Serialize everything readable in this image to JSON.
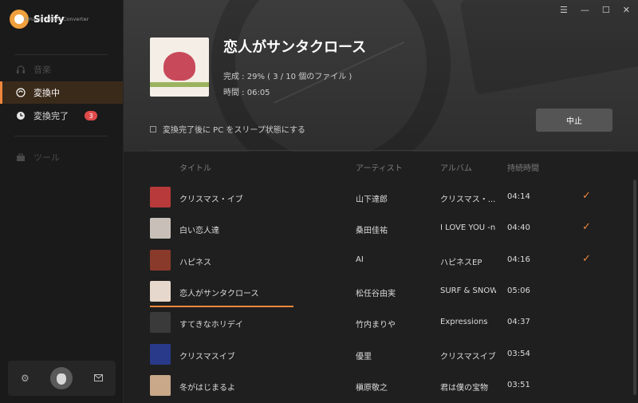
{
  "app": {
    "name": "Sidify",
    "subtitle": "Amazon Music Converter"
  },
  "sidebar": {
    "items": [
      {
        "label": "音楽",
        "icon": "headphones-icon",
        "state": "dim"
      },
      {
        "label": "変換中",
        "icon": "converting-icon",
        "state": "active"
      },
      {
        "label": "変換完了",
        "icon": "clock-icon",
        "state": "normal",
        "badge": "3"
      },
      {
        "label": "ツール",
        "icon": "toolbox-icon",
        "state": "dim"
      }
    ],
    "footer": {
      "settings_icon": "gear-icon",
      "avatar_icon": "avatar",
      "mail_icon": "mail-icon"
    }
  },
  "window_controls": [
    "☰",
    "—",
    "☐",
    "✕"
  ],
  "now_converting": {
    "title": "恋人がサンタクロース",
    "progress": "完成 : 29% ( 3 / 10 個のファイル )",
    "time": "時間 :  06:05",
    "sleep_option": "変換完了後に PC をスリープ状態にする",
    "stop_label": "中止"
  },
  "table": {
    "headers": {
      "title": "タイトル",
      "artist": "アーティスト",
      "album": "アルバム",
      "duration": "持続時間"
    },
    "rows": [
      {
        "title": "クリスマス・イブ",
        "artist": "山下達郎",
        "album": "クリスマス・...",
        "duration": "04:14",
        "done": true,
        "color": "#b83a3a"
      },
      {
        "title": "白い恋人達",
        "artist": "桑田佳祐",
        "album": "I LOVE YOU -n...",
        "duration": "04:40",
        "done": true,
        "color": "#c8c0b8"
      },
      {
        "title": "ハピネス",
        "artist": "AI",
        "album": "ハピネスEP",
        "duration": "04:16",
        "done": true,
        "color": "#8a3a2a"
      },
      {
        "title": "恋人がサンタクロース",
        "artist": "松任谷由実",
        "album": "SURF & SNOW",
        "duration": "05:06",
        "done": false,
        "current": true,
        "color": "#e6d8cc"
      },
      {
        "title": "すてきなホリデイ",
        "artist": "竹内まりや",
        "album": "Expressions",
        "duration": "04:37",
        "done": false,
        "color": "#3a3a3a"
      },
      {
        "title": "クリスマスイブ",
        "artist": "優里",
        "album": "クリスマスイブ",
        "duration": "03:54",
        "done": false,
        "color": "#2a3a8a"
      },
      {
        "title": "冬がはじまるよ",
        "artist": "槇原敬之",
        "album": "君は僕の宝物",
        "duration": "03:51",
        "done": false,
        "color": "#c8a888"
      }
    ]
  },
  "colors": {
    "accent": "#f0873c",
    "badge": "#e04a4a"
  }
}
